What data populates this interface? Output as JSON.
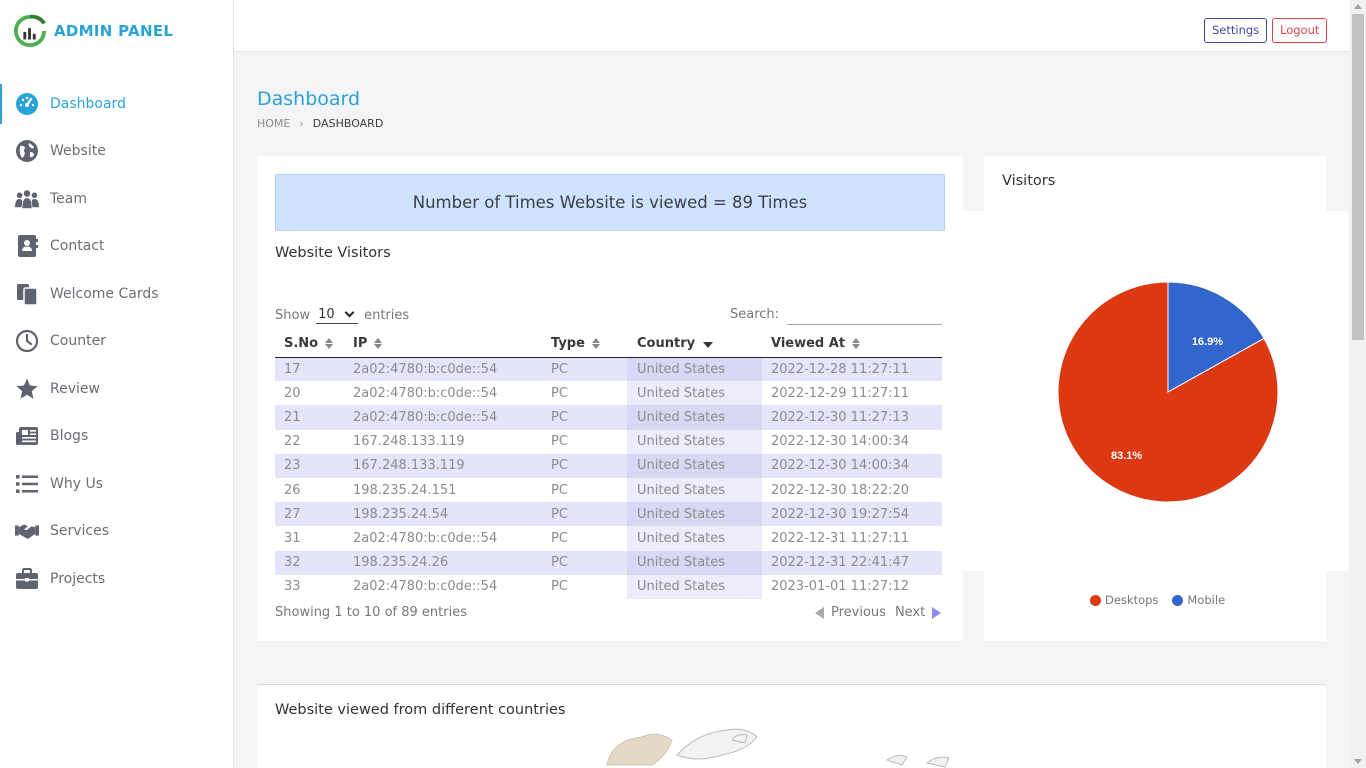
{
  "brand": {
    "name": "ADMIN PANEL"
  },
  "sidebar": {
    "items": [
      {
        "label": "Dashboard",
        "icon": "dashboard-gauge-icon",
        "active": true
      },
      {
        "label": "Website",
        "icon": "globe-icon"
      },
      {
        "label": "Team",
        "icon": "team-icon"
      },
      {
        "label": "Contact",
        "icon": "contact-book-icon"
      },
      {
        "label": "Welcome Cards",
        "icon": "cards-icon"
      },
      {
        "label": "Counter",
        "icon": "clock-icon"
      },
      {
        "label": "Review",
        "icon": "star-icon"
      },
      {
        "label": "Blogs",
        "icon": "newspaper-icon"
      },
      {
        "label": "Why Us",
        "icon": "list-icon"
      },
      {
        "label": "Services",
        "icon": "handshake-icon"
      },
      {
        "label": "Projects",
        "icon": "briefcase-icon"
      }
    ]
  },
  "topbar": {
    "settings_label": "Settings",
    "logout_label": "Logout"
  },
  "page": {
    "title": "Dashboard",
    "breadcrumb": {
      "home": "HOME",
      "separator": "›",
      "current": "DASHBOARD"
    }
  },
  "views_banner": "Number of Times Website is viewed = 89 Times",
  "visitors_table": {
    "title": "Website Visitors",
    "show_label": "Show",
    "entries_label": "entries",
    "page_size": "10",
    "search_label": "Search:",
    "search_value": "",
    "columns": [
      "S.No",
      "IP",
      "Type",
      "Country",
      "Viewed At"
    ],
    "rows": [
      [
        "17",
        "2a02:4780:b:c0de::54",
        "PC",
        "United States",
        "2022-12-28 11:27:11"
      ],
      [
        "20",
        "2a02:4780:b:c0de::54",
        "PC",
        "United States",
        "2022-12-29 11:27:11"
      ],
      [
        "21",
        "2a02:4780:b:c0de::54",
        "PC",
        "United States",
        "2022-12-30 11:27:13"
      ],
      [
        "22",
        "167.248.133.119",
        "PC",
        "United States",
        "2022-12-30 14:00:34"
      ],
      [
        "23",
        "167.248.133.119",
        "PC",
        "United States",
        "2022-12-30 14:00:34"
      ],
      [
        "26",
        "198.235.24.151",
        "PC",
        "United States",
        "2022-12-30 18:22:20"
      ],
      [
        "27",
        "198.235.24.54",
        "PC",
        "United States",
        "2022-12-30 19:27:54"
      ],
      [
        "31",
        "2a02:4780:b:c0de::54",
        "PC",
        "United States",
        "2022-12-31 11:27:11"
      ],
      [
        "32",
        "198.235.24.26",
        "PC",
        "United States",
        "2022-12-31 22:41:47"
      ],
      [
        "33",
        "2a02:4780:b:c0de::54",
        "PC",
        "United States",
        "2023-01-01 11:27:12"
      ]
    ],
    "info": "Showing 1 to 10 of 89 entries",
    "previous_label": "Previous",
    "next_label": "Next"
  },
  "visitors_chart": {
    "title": "Visitors",
    "slice_labels": [
      "83.1%",
      "16.9%"
    ]
  },
  "chart_data": {
    "type": "pie",
    "categories": [
      "Desktops",
      "Mobile"
    ],
    "values": [
      83.1,
      16.9
    ],
    "colors": [
      "#dc3912",
      "#3366cc"
    ],
    "legend": "bottom"
  },
  "countries_section": {
    "title": "Website viewed from different countries"
  },
  "colors": {
    "accent": "#2aa3d8",
    "desktops": "#dc3912",
    "mobile": "#3366cc",
    "logout": "#dc4444",
    "settings": "#3c4aa8"
  }
}
